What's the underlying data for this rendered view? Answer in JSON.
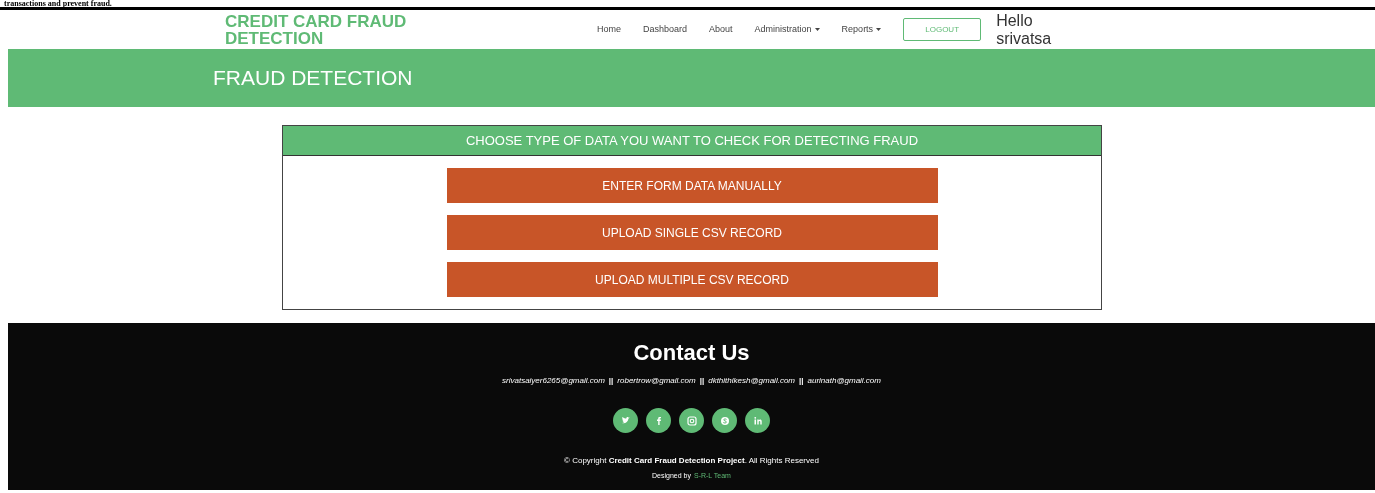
{
  "document_text": "transactions and prevent fraud.",
  "brand": "CREDIT CARD FRAUD DETECTION",
  "nav": [
    {
      "label": "Home",
      "dropdown": false
    },
    {
      "label": "Dashboard",
      "dropdown": false
    },
    {
      "label": "About",
      "dropdown": false
    },
    {
      "label": "Administration",
      "dropdown": true
    },
    {
      "label": "Reports",
      "dropdown": true
    }
  ],
  "logout": "LOGOUT",
  "greeting": "Hello srivatsa",
  "banner_title": "FRAUD DETECTION",
  "panel": {
    "heading": "CHOOSE TYPE OF DATA YOU WANT TO CHECK FOR DETECTING FRAUD",
    "buttons": [
      "ENTER FORM DATA MANUALLY",
      "UPLOAD SINGLE CSV RECORD",
      "UPLOAD MULTIPLE CSV RECORD"
    ]
  },
  "footer": {
    "title": "Contact Us",
    "emails": [
      "srivatsaiyer6265@gmail.com",
      "robertrow@gmail.com",
      "dkthithikesh@gmail.com",
      "aurinath@gmail.com"
    ],
    "separator": "||",
    "social": [
      {
        "kind": "twitter"
      },
      {
        "kind": "facebook"
      },
      {
        "kind": "instagram"
      },
      {
        "kind": "skype"
      },
      {
        "kind": "linkedin"
      }
    ],
    "copyright": "© Copyright **Credit Card Fraud Detection Project**. All Rights Reserved",
    "designed_by": "Designed by",
    "team": "S-R-L Team"
  }
}
